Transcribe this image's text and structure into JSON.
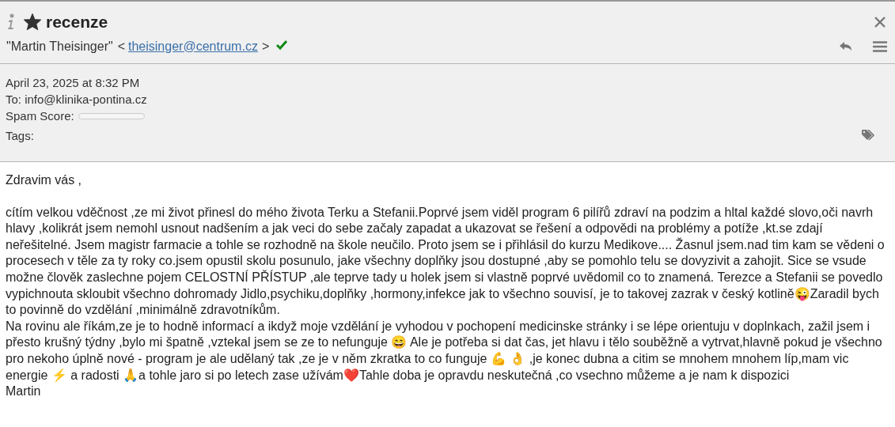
{
  "message": {
    "subject": "recenze",
    "starred": true,
    "sender_name": "\"Martin Theisinger\"",
    "open_bracket": "<",
    "sender_email": "theisinger@centrum.cz",
    "close_bracket": ">",
    "verified": true,
    "date": "April 23, 2025 at 8:32 PM",
    "to": "To: info@klinika-pontina.cz",
    "spam_score": {
      "label": "Spam Score:",
      "level": 0
    },
    "tags_label": "Tags:"
  },
  "body": [
    "Zdravim vás ,",
    "cítím velkou vděčnost ,ze mi život přinesl do mého života Terku a Stefanii.Poprvé jsem viděl program 6 pilířů zdraví na podzim a hltal každé slovo,oči navrh hlavy ,kolikrát jsem nemohl usnout nadšením a jak veci do sebe začaly zapadat a  ukazovat se řešení a odpovědi na problémy a potíže ,kt.se zdají neřešitelné. Jsem magistr farmacie a tohle se rozhodně na škole neučilo. Proto jsem se i přihlásil do kurzu Medikove.... Žasnul jsem.nad tim kam se vědeni o procesech v těle za ty roky co.jsem opustil skolu posunulo, jake všechny doplňky jsou dostupné ,aby se pomohlo telu se dovyzivit a zahojit. Sice se vsude možne člověk zaslechne pojem CELOSTNÍ PŘÍSTUP ,ale teprve tady u holek jsem si vlastně poprvé uvědomil co to znamená. Terezce a Stefanii se povedlo vypichnouta skloubit všechno dohromady Jidlo,psychiku,doplňky ,hormony,infekce jak to všechno souvisí, je to takovej zazrak v český kotlině😜Zaradil bych to povinně do vzdělání ,minimálně zdravotníkům.",
    "Na rovinu ale říkám,ze je to hodně informací a ikdyž moje vzdělání je vyhodou v pochopení medicinske stránky i se lépe orientuju v doplnkach, zažil jsem i přesto krušný týdny ,bylo mi špatně ,vztekal jsem se ze to nefunguje 😄 Ale je potřeba si dat čas, jet hlavu i tělo souběžně a vytrvat,hlavně pokud je všechno pro nekoho úplně nové - program je ale udělaný tak ,ze je v něm zkratka to co funguje 💪 👌 ,je konec dubna a citim se mnohem mnohem líp,mam vic energie ⚡ a radosti 🙏a tohle jaro si po letech zase užívám❤️Tahle doba je opravdu neskutečná ,co vsechno můžeme a je nam k dispozici",
    "Martin"
  ]
}
